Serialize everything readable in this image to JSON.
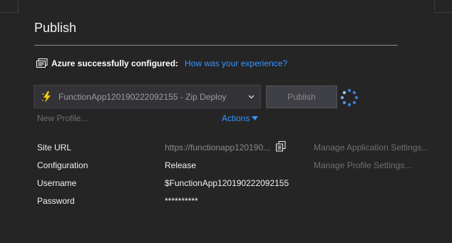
{
  "page": {
    "title": "Publish"
  },
  "status": {
    "message": "Azure successfully configured:",
    "feedback_link": "How was your experience?",
    "icon": "publish-status-icon"
  },
  "profile": {
    "selected": "FunctionApp120190222092155 - Zip Deploy",
    "icon": "lightning-bolt-icon"
  },
  "toolbar": {
    "publish_label": "Publish",
    "new_profile_label": "New Profile...",
    "actions_label": "Actions"
  },
  "details": {
    "site_url_label": "Site URL",
    "site_url_value": "https://functionapp120190...",
    "configuration_label": "Configuration",
    "configuration_value": "Release",
    "username_label": "Username",
    "username_value": "$FunctionApp120190222092155",
    "password_label": "Password",
    "password_value": "**********"
  },
  "side_links": {
    "app_settings": "Manage Application Settings...",
    "profile_settings": "Manage Profile Settings..."
  },
  "colors": {
    "background": "#252526",
    "link": "#3794ff",
    "bolt": "#f2c811"
  }
}
